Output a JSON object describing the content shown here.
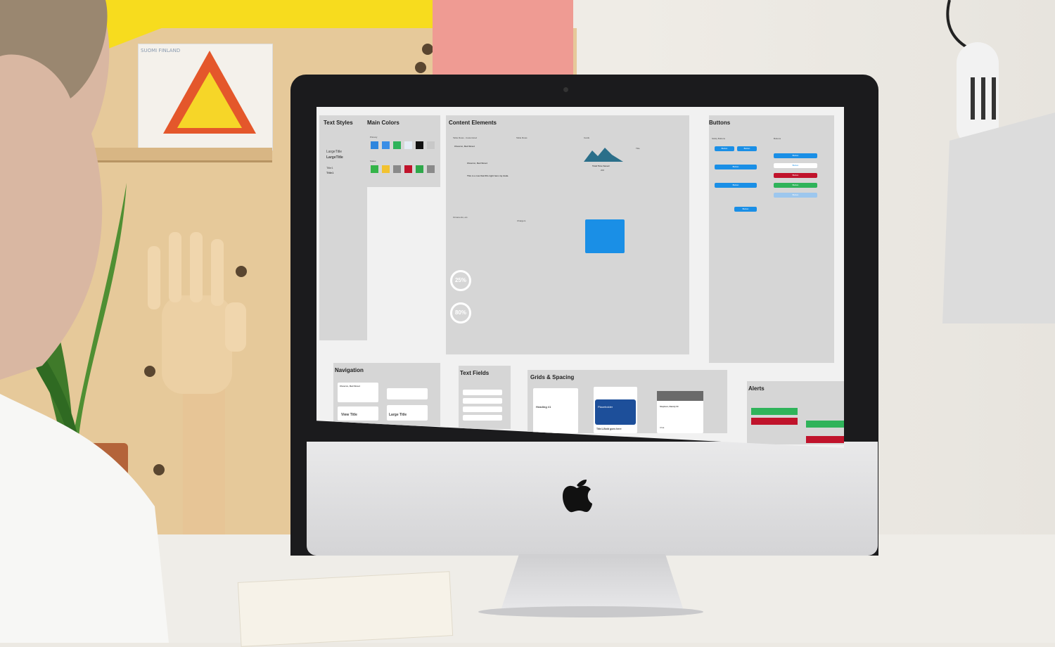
{
  "screen": {
    "boards": {
      "text_styles": {
        "title": "Text Styles",
        "samples": [
          "LargeTitle",
          "LargeTitle",
          "Title1",
          "Title1"
        ]
      },
      "main_colors": {
        "title": "Main Colors",
        "primary_label": "Primary",
        "status_label": "Status",
        "primary_colors": [
          "#2e86de",
          "#3a8ee6",
          "#2fb35a",
          "#e4ecf6",
          "#111111",
          "#c8c8c8"
        ],
        "status_colors": [
          "#34b449",
          "#f2c230",
          "#8a8a8a",
          "#c0132b",
          "#2ea84a",
          "#8a8a8a"
        ]
      },
      "content_elements": {
        "title": "Content Elements",
        "labels": {
          "table_rows_customized": "Table Rows - Customized",
          "table_rows": "Table Rows",
          "cards": "Cards",
          "ornaments": "Ornaments, etc.",
          "chargers": "Chargers",
          "title_small": "Title"
        },
        "row_items": [
          "Chevron, Red Street",
          "Chevron, Red Street",
          "This is a row that fills right here my dude."
        ],
        "card_stat": {
          "label": "Total Time Saved",
          "value": "200"
        },
        "progress": [
          {
            "value": "25%"
          },
          {
            "value": "80%"
          }
        ]
      },
      "buttons": {
        "title": "Buttons",
        "sticky_label": "Sticky Buttons",
        "buttons_label": "Buttons",
        "button_text": "Button",
        "variant_colors": [
          "#1a8fe6",
          "#ffffff",
          "#c0132b",
          "#2fb35a",
          "#9dc7ee"
        ]
      },
      "navigation": {
        "title": "Navigation",
        "card_title": "Chevron, Red Street",
        "view_title": "View Title",
        "large_title": "Large Title"
      },
      "text_fields": {
        "title": "Text Fields"
      },
      "grids": {
        "title": "Grids & Spacing",
        "heading": "Heading #1",
        "placeholder": "Placeholder",
        "caption": "Title1-Bold goes here",
        "profile_name": "Stephen, Dandy Dr",
        "profile_sub": "Chat"
      },
      "alerts": {
        "title": "Alerts",
        "alert_colors": [
          "#2fb35a",
          "#c0132b",
          "#2fb35a",
          "#c0132b"
        ]
      }
    }
  },
  "scene": {
    "sign_text": "SUOMI FINLAND"
  }
}
